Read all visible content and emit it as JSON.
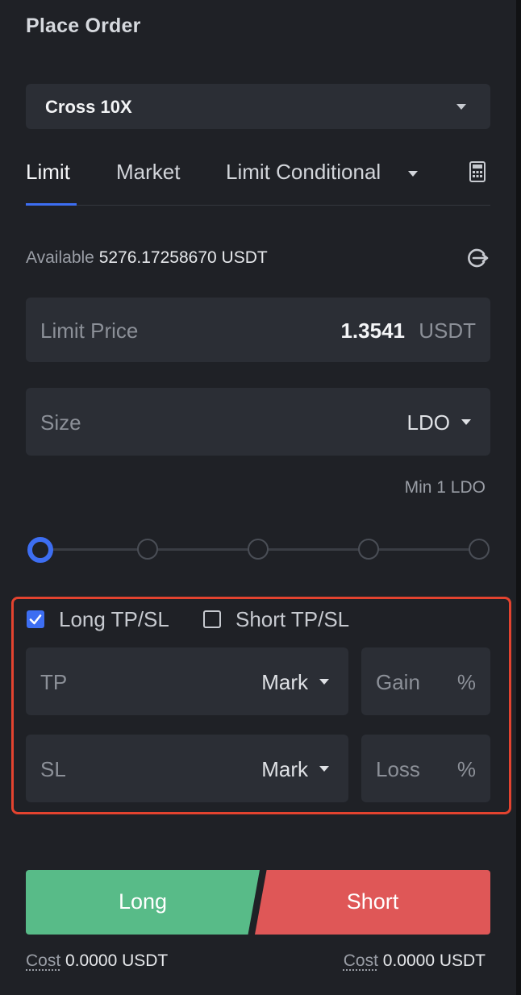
{
  "title": "Place Order",
  "margin_mode": "Cross 10X",
  "tabs": [
    {
      "label": "Limit",
      "active": true
    },
    {
      "label": "Market",
      "active": false
    },
    {
      "label": "Limit Conditional",
      "active": false
    }
  ],
  "icons": {
    "margin_caret": "chevron-down-icon",
    "conditional_caret": "chevron-down-icon",
    "calculator": "calculator-icon",
    "transfer": "transfer-icon"
  },
  "available": {
    "label": "Available",
    "amount": "5276.17258670",
    "currency": "USDT"
  },
  "limit_price": {
    "placeholder": "Limit Price",
    "value": "1.3541",
    "unit": "USDT"
  },
  "size": {
    "placeholder": "Size",
    "unit": "LDO"
  },
  "min_note": "Min 1 LDO",
  "slider": {
    "steps": 5,
    "value_percent": 0
  },
  "tpsl": {
    "long_label": "Long TP/SL",
    "long_checked": true,
    "short_label": "Short TP/SL",
    "short_checked": false,
    "tp": {
      "placeholder": "TP",
      "trigger": "Mark"
    },
    "sl": {
      "placeholder": "SL",
      "trigger": "Mark"
    },
    "gain": {
      "placeholder": "Gain",
      "unit": "%"
    },
    "loss": {
      "placeholder": "Loss",
      "unit": "%"
    }
  },
  "buttons": {
    "long": "Long",
    "short": "Short"
  },
  "cost": {
    "long": {
      "label": "Cost",
      "value": "0.0000 USDT"
    },
    "short": {
      "label": "Cost",
      "value": "0.0000 USDT"
    }
  },
  "colors": {
    "accent": "#3d6ef2",
    "long": "#58bb88",
    "short": "#df5757",
    "highlight_border": "#e3432f",
    "background": "#1f2126",
    "field": "#2b2e35"
  }
}
